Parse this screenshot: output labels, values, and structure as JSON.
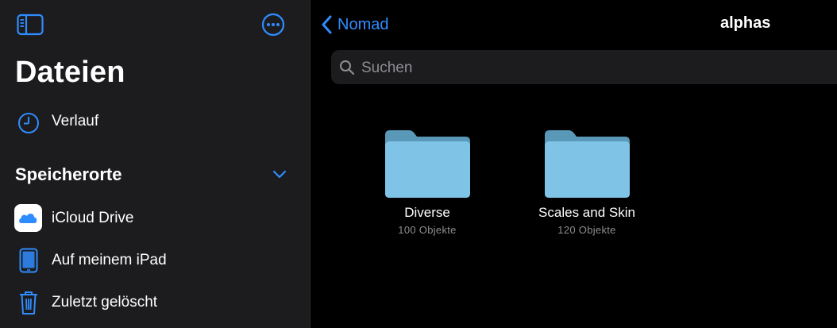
{
  "sidebar": {
    "title": "Dateien",
    "recents_label": "Verlauf",
    "section_title": "Speicherorte",
    "locations": [
      {
        "label": "iCloud Drive",
        "icon": "icloud-drive-icon"
      },
      {
        "label": "Auf meinem iPad",
        "icon": "ipad-icon"
      },
      {
        "label": "Zuletzt gelöscht",
        "icon": "trash-icon"
      }
    ]
  },
  "navigation": {
    "back_label": "Nomad",
    "title": "alphas"
  },
  "search": {
    "placeholder": "Suchen",
    "value": ""
  },
  "folders": [
    {
      "name": "Diverse",
      "count": "100 Objekte"
    },
    {
      "name": "Scales and Skin",
      "count": "120 Objekte"
    }
  ],
  "colors": {
    "accent": "#2f8cff",
    "sidebar_bg": "#1c1c1e",
    "main_bg": "#000000",
    "folder": "#7fc4e6",
    "secondary_text": "#8e8e93"
  }
}
